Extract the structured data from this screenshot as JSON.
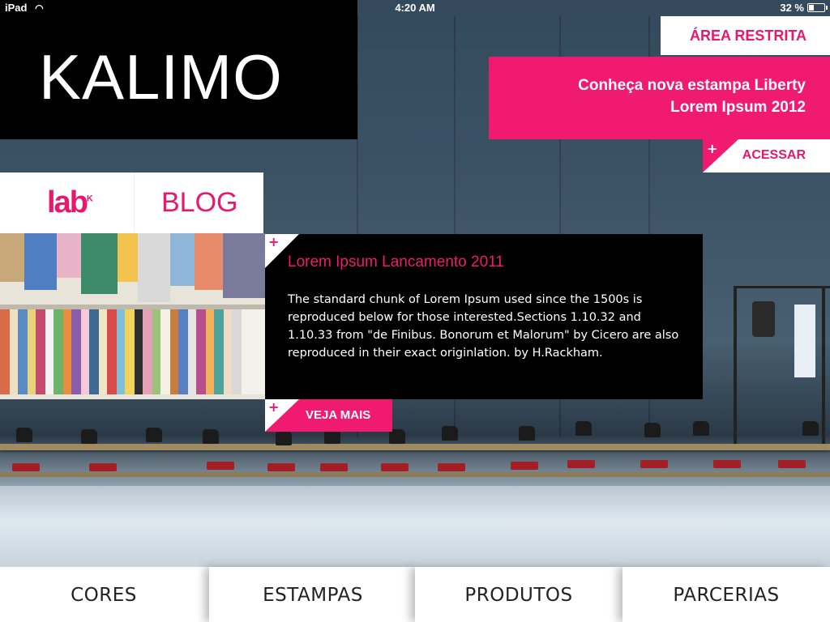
{
  "status_bar": {
    "device": "iPad",
    "time": "4:20 AM",
    "battery": "32 %",
    "battery_level": 0.32
  },
  "brand": {
    "logo_text": "KALIMO"
  },
  "header": {
    "restricted_area": "ÁREA RESTRITA"
  },
  "promo": {
    "line1": "Conheça nova estampa Liberty",
    "line2": "Lorem Ipsum 2012",
    "access_plus": "+",
    "access_label": "ACESSAR"
  },
  "tabs": {
    "lab": "lab",
    "lab_mark": "K",
    "blog": "BLOG"
  },
  "article": {
    "plus": "+",
    "title": "Lorem Ipsum Lancamento 2011",
    "body": "The standard chunk of Lorem Ipsum used since the 1500s is reproduced below for those interested.Sections 1.10.32 and 1.10.33 from \"de Finibus. Bonorum et Malorum\" by Cicero are also reproduced in their exact originlation. by H.Rackham.",
    "more_plus": "+",
    "more_label": "VEJA MAIS"
  },
  "nav": {
    "items": [
      "CORES",
      "ESTAMPAS",
      "PRODUTOS",
      "PARCERIAS"
    ]
  },
  "colors": {
    "accent": "#f01a71",
    "logo_bg": "#000000"
  }
}
